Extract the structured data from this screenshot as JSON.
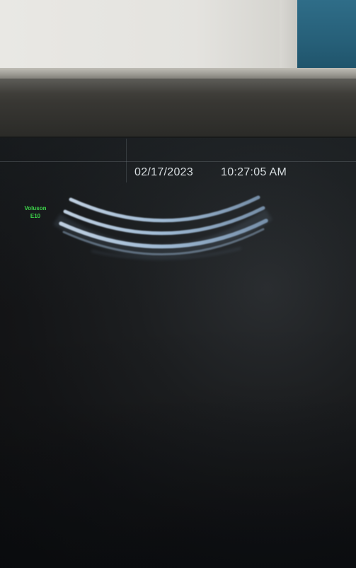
{
  "screen": {
    "date": "02/17/2023",
    "time": "10:27:05 AM",
    "probe": {
      "line1": "Voluson",
      "line2": "E10"
    }
  },
  "colors": {
    "overlay_text": "#d7dde0",
    "probe_label": "#3dd44a",
    "echo_arcs": "#a9c3dc",
    "screen_background": "#141517"
  },
  "image_content": "curved-array ultrasound echo bands (no visible tissue)"
}
